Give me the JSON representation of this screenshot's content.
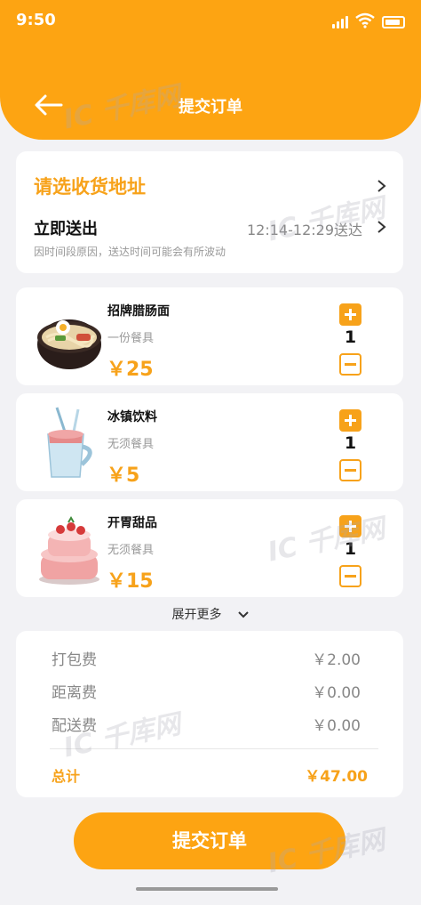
{
  "status_bar": {
    "time": "9:50"
  },
  "header": {
    "title": "提交订单"
  },
  "address": {
    "title": "请选收货地址",
    "delivery_label": "立即送出",
    "delivery_time": "12:14-12:29送达",
    "delivery_note": "因时间段原因，送达时间可能会有所波动"
  },
  "items": [
    {
      "name": "招牌腊肠面",
      "desc": "一份餐具",
      "price": "￥25",
      "qty": "1",
      "icon": "noodle-bowl-icon"
    },
    {
      "name": "冰镇饮料",
      "desc": "无须餐具",
      "price": "￥5",
      "qty": "1",
      "icon": "iced-drink-icon"
    },
    {
      "name": "开胃甜品",
      "desc": "无须餐具",
      "price": "￥15",
      "qty": "1",
      "icon": "strawberry-cake-icon"
    }
  ],
  "expand_label": "展开更多",
  "fees": [
    {
      "label": "打包费",
      "value": "￥2.00"
    },
    {
      "label": "距离费",
      "value": "￥0.00"
    },
    {
      "label": "配送费",
      "value": "￥0.00"
    }
  ],
  "total": {
    "label": "总计",
    "value": "￥47.00"
  },
  "submit_label": "提交订单",
  "watermark": "IC 千库网",
  "colors": {
    "accent": "#fda412",
    "price": "#f7a21a",
    "background": "#f2f2f5"
  }
}
